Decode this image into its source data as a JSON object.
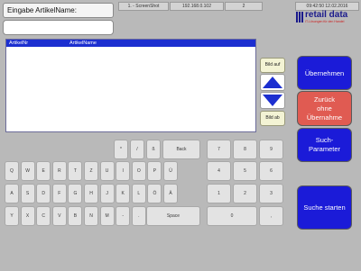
{
  "header": {
    "field_label": "Eingabe ArtikelName:",
    "field_value": "",
    "screen_name": "1. - ScreenShot",
    "ip_address": "192.168.0.102",
    "page": "2",
    "datetime": "09:42:50 12.02.2016"
  },
  "logo": {
    "name": "retail data",
    "tagline": "IT-Lösungen für den Handel"
  },
  "list": {
    "columns": [
      "ArtikelNr",
      "ArtikelName"
    ]
  },
  "scroll": {
    "page_up": "Bild auf",
    "page_down": "Bild ab"
  },
  "actions": {
    "accept": "Übernehmen",
    "back": "Zurück\nohne\nÜbernahme",
    "search_params": "Such-\nParameter",
    "start_search": "Suche starten"
  },
  "keyboard": {
    "special_row": [
      "*",
      "/",
      "ß",
      "Back"
    ],
    "row1": [
      "Q",
      "W",
      "E",
      "R",
      "T",
      "Z",
      "U",
      "I",
      "O",
      "P",
      "Ü"
    ],
    "row2": [
      "A",
      "S",
      "D",
      "F",
      "G",
      "H",
      "J",
      "K",
      "L",
      "Ö",
      "Ä"
    ],
    "row3": [
      "Y",
      "X",
      "C",
      "V",
      "B",
      "N",
      "M",
      "-",
      ".",
      "Space"
    ],
    "numpad": [
      "7",
      "8",
      "9",
      "4",
      "5",
      "6",
      "1",
      "2",
      "3",
      "0",
      ","
    ]
  }
}
